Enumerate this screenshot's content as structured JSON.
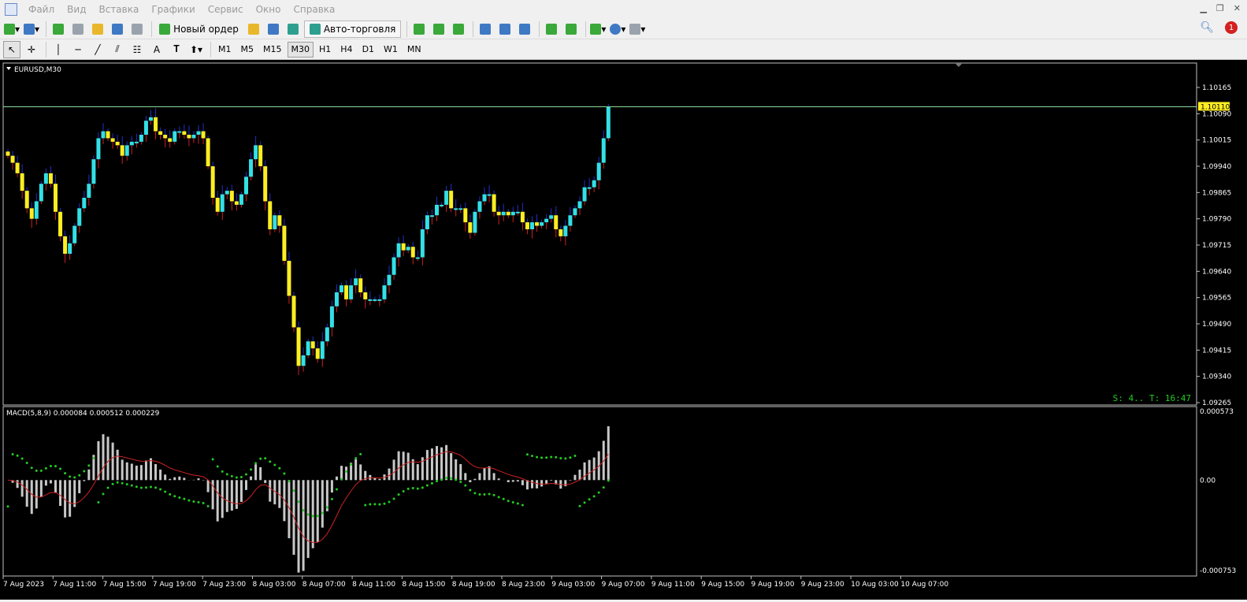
{
  "menu": [
    "Файл",
    "Вид",
    "Вставка",
    "Графики",
    "Сервис",
    "Окно",
    "Справка"
  ],
  "toolbar": {
    "new_order_label": "Новый ордер",
    "auto_trading_label": "Авто-торговля"
  },
  "timeframes": [
    "M1",
    "M5",
    "M15",
    "M30",
    "H1",
    "H4",
    "D1",
    "W1",
    "MN"
  ],
  "active_timeframe": "M30",
  "notifications_count": "1",
  "chart": {
    "symbol_label": "EURUSD,M30",
    "current_price": "1.10110",
    "price_axis_labels": [
      "1.10165",
      "1.10090",
      "1.10015",
      "1.09940",
      "1.09865",
      "1.09790",
      "1.09715",
      "1.09640",
      "1.09565",
      "1.09490",
      "1.09415",
      "1.09340",
      "1.09265"
    ],
    "status_text": "S: 4.. T: 16:47",
    "colors": {
      "bull": "#33e0e6",
      "bear": "#ffee22",
      "wick_up": "#2030c8",
      "wick_down": "#cc2020",
      "price_line": "#88dd99",
      "macd_hist": "#c8c8c8",
      "macd_signal": "#cc2222",
      "dots": "#22cc22"
    }
  },
  "macd": {
    "label": "MACD(5,8,9) 0.000084 0.000512 0.000229",
    "axis_labels": [
      "0.000573",
      "0.00",
      "-0.000753"
    ]
  },
  "time_axis_labels": [
    "7 Aug 2023",
    "7 Aug 11:00",
    "7 Aug 15:00",
    "7 Aug 19:00",
    "7 Aug 23:00",
    "8 Aug 03:00",
    "8 Aug 07:00",
    "8 Aug 11:00",
    "8 Aug 15:00",
    "8 Aug 19:00",
    "8 Aug 23:00",
    "9 Aug 03:00",
    "9 Aug 07:00",
    "9 Aug 11:00",
    "9 Aug 15:00",
    "9 Aug 19:00",
    "9 Aug 23:00",
    "10 Aug 03:00",
    "10 Aug 07:00"
  ],
  "chart_data": {
    "type": "candlestick",
    "closes": [
      1.0997,
      1.0995,
      1.0992,
      1.0987,
      1.0982,
      1.0979,
      1.0984,
      1.0989,
      1.0992,
      1.0989,
      1.0981,
      1.0974,
      1.0969,
      1.0972,
      1.0977,
      1.0982,
      1.0985,
      1.0989,
      1.0996,
      1.1002,
      1.1004,
      1.1002,
      1.1001,
      1.1,
      1.0997,
      1.1,
      1.1001,
      1.1001,
      1.1003,
      1.1007,
      1.1008,
      1.1004,
      1.1003,
      1.1002,
      1.1001,
      1.1004,
      1.1004,
      1.1003,
      1.1002,
      1.1003,
      1.1004,
      1.1002,
      1.0994,
      1.0985,
      1.0981,
      1.0986,
      1.0987,
      1.0984,
      1.0983,
      1.0986,
      1.0991,
      1.0996,
      1.1,
      1.0994,
      1.0984,
      1.0976,
      1.098,
      1.0977,
      1.0967,
      1.0957,
      1.0948,
      1.0937,
      1.094,
      1.0944,
      1.0942,
      1.0939,
      1.0944,
      1.0948,
      1.0954,
      1.0958,
      1.096,
      1.0956,
      1.096,
      1.0962,
      1.0958,
      1.0956,
      1.0956,
      1.0956,
      1.0956,
      1.096,
      1.0963,
      1.0968,
      1.0972,
      1.097,
      1.0971,
      1.0968,
      1.0968,
      1.0976,
      1.098,
      1.098,
      1.0983,
      1.0983,
      1.0987,
      1.0982,
      1.0982,
      1.0982,
      1.0978,
      1.0975,
      1.0981,
      1.0984,
      1.0986,
      1.0986,
      1.0981,
      1.098,
      1.0981,
      1.098,
      1.0981,
      1.0981,
      1.0978,
      1.0976,
      1.0978,
      1.0977,
      1.0978,
      1.0979,
      1.098,
      1.0976,
      1.0974,
      1.0977,
      1.098,
      1.0982,
      1.0984,
      1.0988,
      1.0988,
      1.099,
      1.0995,
      1.1002,
      1.1011
    ]
  }
}
